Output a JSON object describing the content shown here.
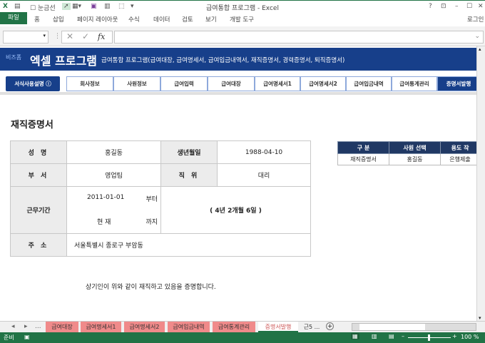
{
  "window": {
    "title": "급여통합 프로그램 - Excel",
    "gridlines_label": "눈금선",
    "help": "?",
    "min": "–",
    "max": "☐",
    "close": "✕"
  },
  "ribbon": {
    "file": "파일",
    "tabs": [
      "홈",
      "삽입",
      "페이지 레이아웃",
      "수식",
      "데이터",
      "검토",
      "보기",
      "개발 도구"
    ],
    "login": "로그인"
  },
  "formula_bar": {
    "name_box": "",
    "cancel": "✕",
    "enter": "✓",
    "fx": "fx",
    "formula": ""
  },
  "banner": {
    "logo": "비즈폼",
    "title": "엑셀 프로그램",
    "subtitle": "급여통합 프로그램(급여대장, 급여명세서, 급여입금내역서, 재직증명서, 경력증명서, 퇴직증명서)"
  },
  "nav": {
    "help_button": "서식사용설명",
    "items": [
      "회사정보",
      "사원정보",
      "급여입력",
      "급여대장",
      "급여명세서1",
      "급여명세서2",
      "급여입금내역",
      "급여통계관리",
      "증명서발행"
    ]
  },
  "document": {
    "title": "재직증명서",
    "name_label": "성 명",
    "name": "홍길동",
    "birth_label": "생년월일",
    "birth": "1988-04-10",
    "dept_label": "부 서",
    "dept": "영업팀",
    "position_label": "직 위",
    "position": "대리",
    "period_label": "근무기간",
    "start_date": "2011-01-01",
    "from_label": "부터",
    "end_date": "현 재",
    "to_label": "까지",
    "duration": "( 4년 2개월 6일 )",
    "address_label": "주 소",
    "address": "서울특별시 종로구 부암동",
    "statement": "상기인이  위와 같이 재직하고 있음을 증명합니다."
  },
  "selector": {
    "headers": [
      "구 분",
      "사원 선택",
      "용도 작"
    ],
    "row": [
      "재직증명서",
      "홍길동",
      "은행제출"
    ]
  },
  "sheet_tabs": {
    "nav": [
      "◂",
      "▸",
      "..."
    ],
    "tabs": [
      "급여대장",
      "급여명세서1",
      "급여명세서2",
      "급여입금내역",
      "급여통계관리",
      "증명서발행",
      "근5 ..."
    ],
    "add": "+"
  },
  "status": {
    "ready": "준비",
    "zoom": "100 %"
  },
  "colors": {
    "excel_green": "#217346",
    "banner_blue": "#173f8a",
    "header_navy": "#203864",
    "tab_red": "#f08a8a"
  }
}
